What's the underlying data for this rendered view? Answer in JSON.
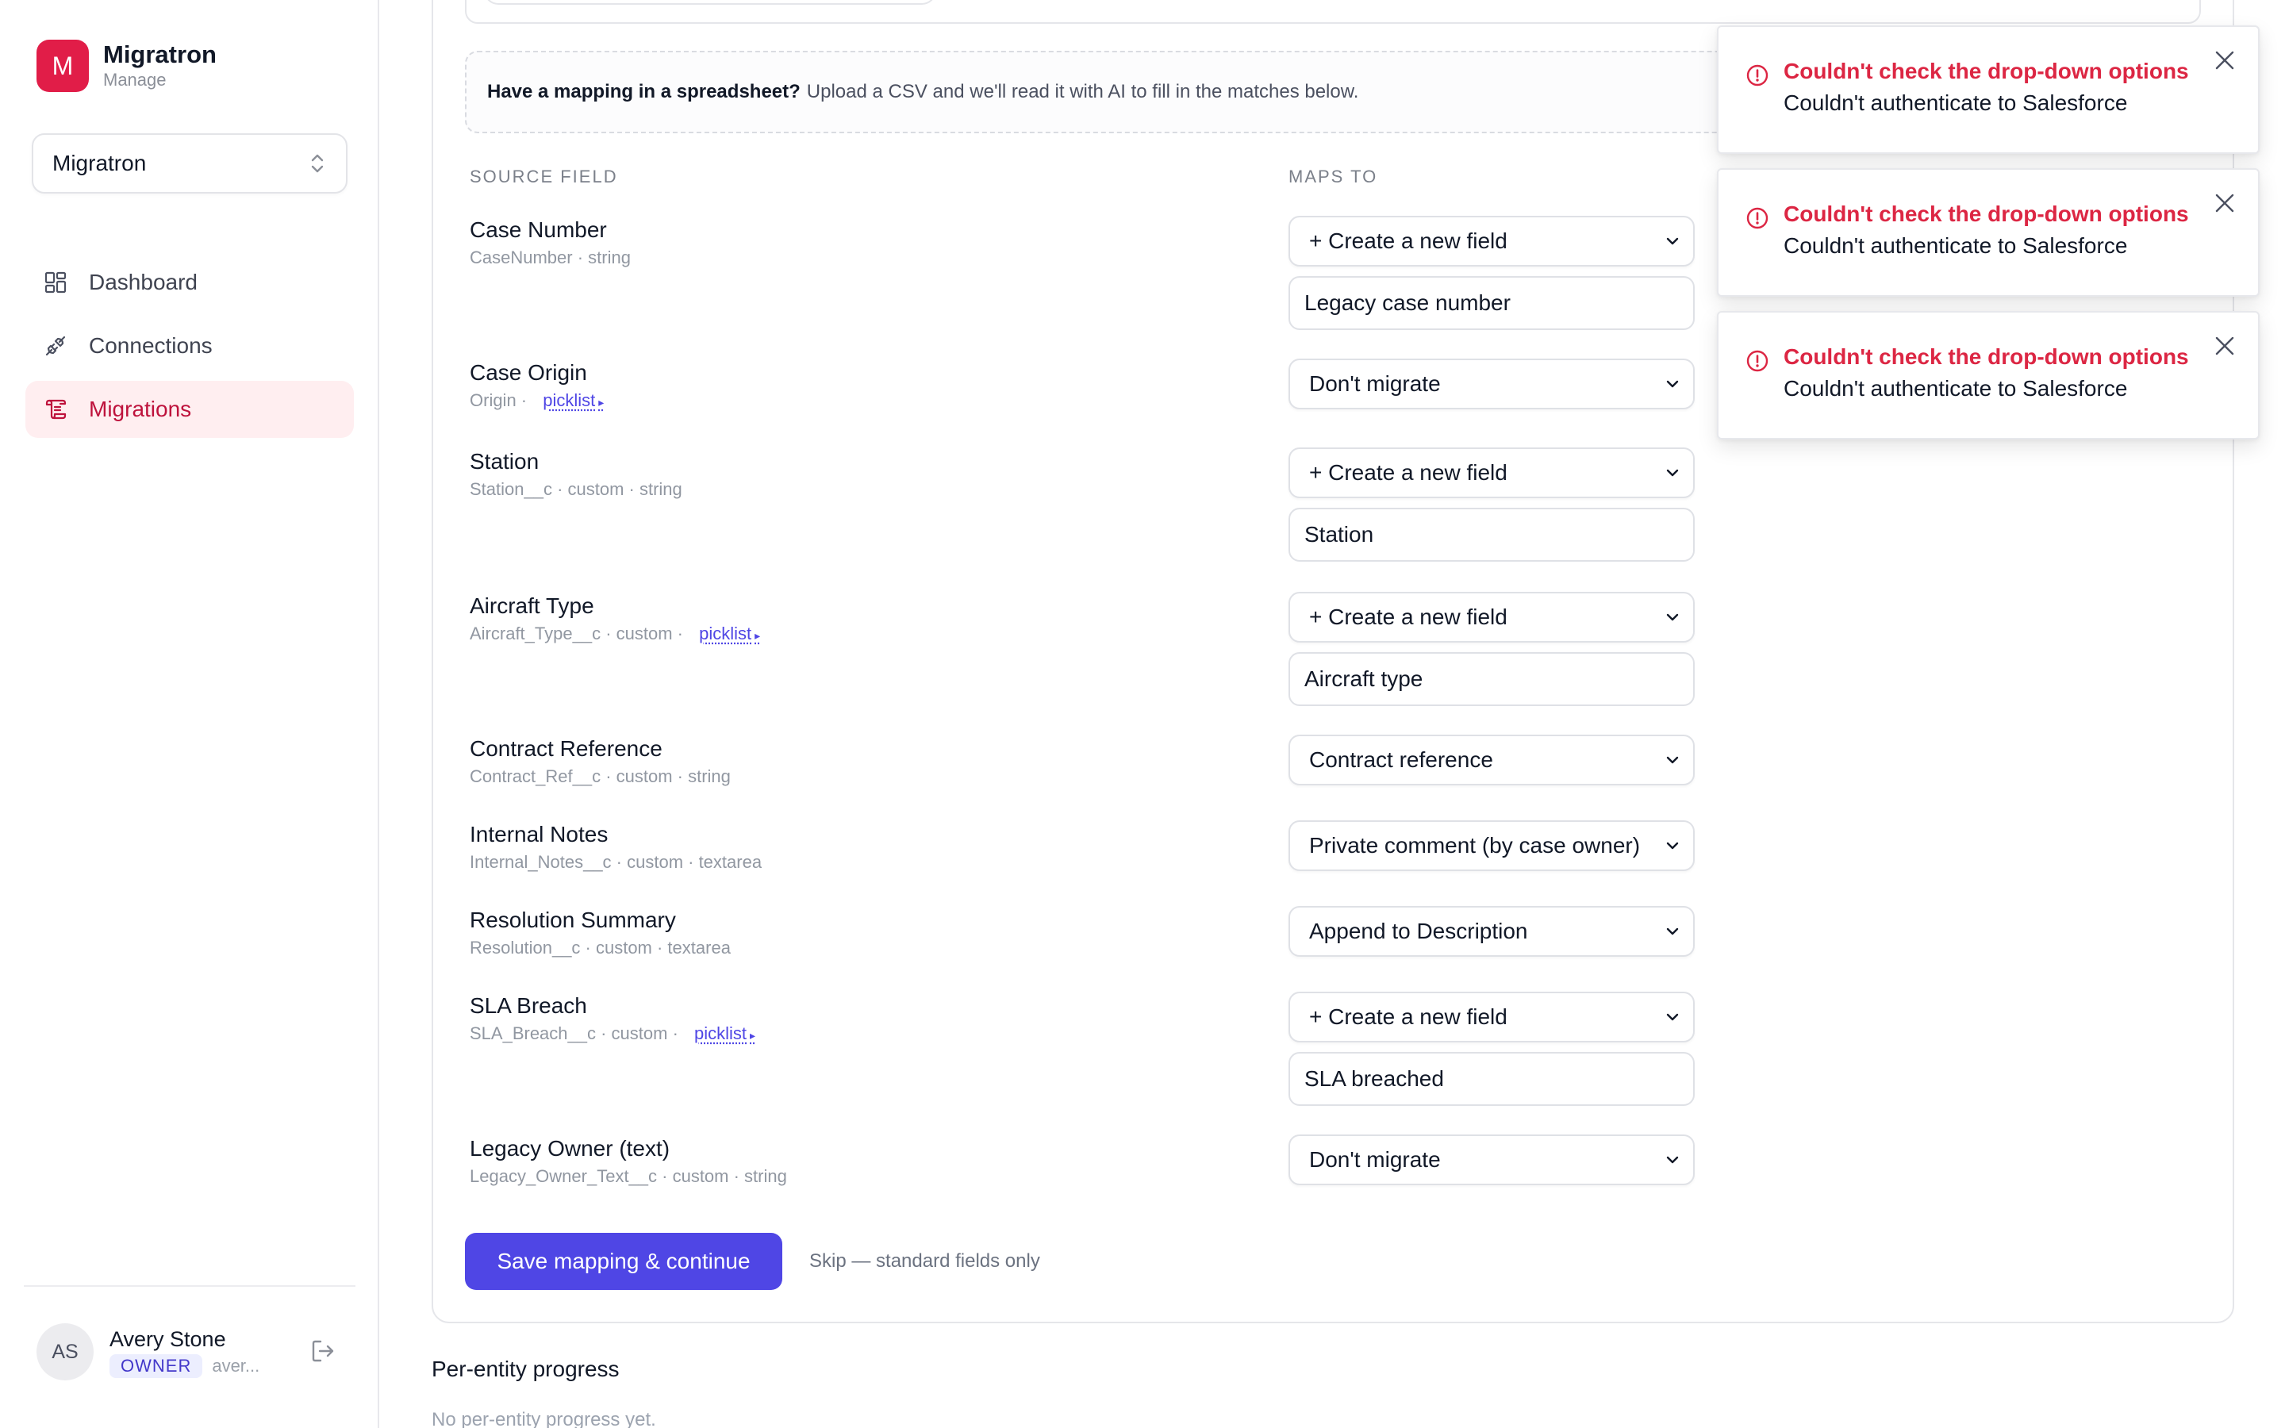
{
  "brand": {
    "logo_letter": "M",
    "name": "Migratron",
    "subtitle": "Manage"
  },
  "workspace": {
    "selected": "Migratron"
  },
  "nav": {
    "items": [
      {
        "label": "Dashboard",
        "icon": "dashboard-icon",
        "active": false
      },
      {
        "label": "Connections",
        "icon": "plug-icon",
        "active": false
      },
      {
        "label": "Migrations",
        "icon": "scroll-icon",
        "active": true
      }
    ]
  },
  "user": {
    "initials": "AS",
    "name": "Avery Stone",
    "role": "OWNER",
    "email": "aver..."
  },
  "upload": {
    "bold": "Have a mapping in a spreadsheet?",
    "text": "Upload a CSV and we'll read it with AI to fill in the matches below."
  },
  "columns": {
    "source": "SOURCE FIELD",
    "target": "MAPS TO"
  },
  "rows": [
    {
      "title": "Case Number",
      "meta": "CaseNumber · string",
      "picklist": "",
      "select": "+ Create a new field",
      "input": "Legacy case number"
    },
    {
      "title": "Case Origin",
      "meta": "Origin · ",
      "picklist": "picklist",
      "select": "Don't migrate",
      "input": ""
    },
    {
      "title": "Station",
      "meta": "Station__c · custom · string",
      "picklist": "",
      "select": "+ Create a new field",
      "input": "Station"
    },
    {
      "title": "Aircraft Type",
      "meta": "Aircraft_Type__c · custom · ",
      "picklist": "picklist",
      "select": "+ Create a new field",
      "input": "Aircraft type"
    },
    {
      "title": "Contract Reference",
      "meta": "Contract_Ref__c · custom · string",
      "picklist": "",
      "select": "Contract reference",
      "input": ""
    },
    {
      "title": "Internal Notes",
      "meta": "Internal_Notes__c · custom · textarea",
      "picklist": "",
      "select": "Private comment (by case owner)",
      "input": ""
    },
    {
      "title": "Resolution Summary",
      "meta": "Resolution__c · custom · textarea",
      "picklist": "",
      "select": "Append to Description",
      "input": ""
    },
    {
      "title": "SLA Breach",
      "meta": "SLA_Breach__c · custom · ",
      "picklist": "picklist",
      "select": "+ Create a new field",
      "input": "SLA breached"
    },
    {
      "title": "Legacy Owner (text)",
      "meta": "Legacy_Owner_Text__c · custom · string",
      "picklist": "",
      "select": "Don't migrate",
      "input": ""
    }
  ],
  "actions": {
    "save": "Save mapping & continue",
    "skip": "Skip — standard fields only"
  },
  "progress": {
    "title": "Per-entity progress",
    "empty": "No per-entity progress yet."
  },
  "toasts": [
    {
      "title": "Couldn't check the drop-down options",
      "message": "Couldn't authenticate to Salesforce"
    },
    {
      "title": "Couldn't check the drop-down options",
      "message": "Couldn't authenticate to Salesforce"
    },
    {
      "title": "Couldn't check the drop-down options",
      "message": "Couldn't authenticate to Salesforce"
    }
  ],
  "colors": {
    "brand": "#e11d48",
    "accent": "#4f46e5",
    "error": "#dc2643",
    "active_nav_bg": "#ffeef0"
  }
}
